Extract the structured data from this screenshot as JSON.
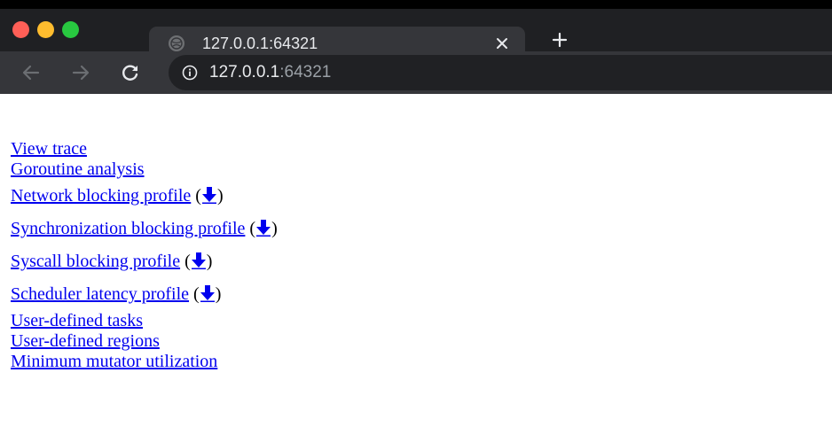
{
  "colors": {
    "close": "#ff5f57",
    "minimize": "#febc2e",
    "zoom": "#28c840",
    "link": "#0000ee"
  },
  "tab": {
    "title": "127.0.0.1:64321",
    "favicon": "globe-icon",
    "close_icon": "close-icon",
    "new_tab_icon": "plus-icon"
  },
  "toolbar": {
    "back_icon": "arrow-left-icon",
    "forward_icon": "arrow-right-icon",
    "reload_icon": "reload-icon",
    "info_icon": "info-icon",
    "url_host": "127.0.0.1",
    "url_port": ":64321"
  },
  "links": [
    {
      "label": "View trace"
    },
    {
      "label": "Goroutine analysis"
    },
    {
      "label": "Network blocking profile",
      "download": true
    },
    {
      "label": "Synchronization blocking profile",
      "download": true
    },
    {
      "label": "Syscall blocking profile",
      "download": true
    },
    {
      "label": "Scheduler latency profile",
      "download": true
    },
    {
      "label": "User-defined tasks"
    },
    {
      "label": "User-defined regions"
    },
    {
      "label": "Minimum mutator utilization"
    }
  ],
  "download_icon": "arrow-down-icon",
  "paren_open": "(",
  "paren_close": ")"
}
